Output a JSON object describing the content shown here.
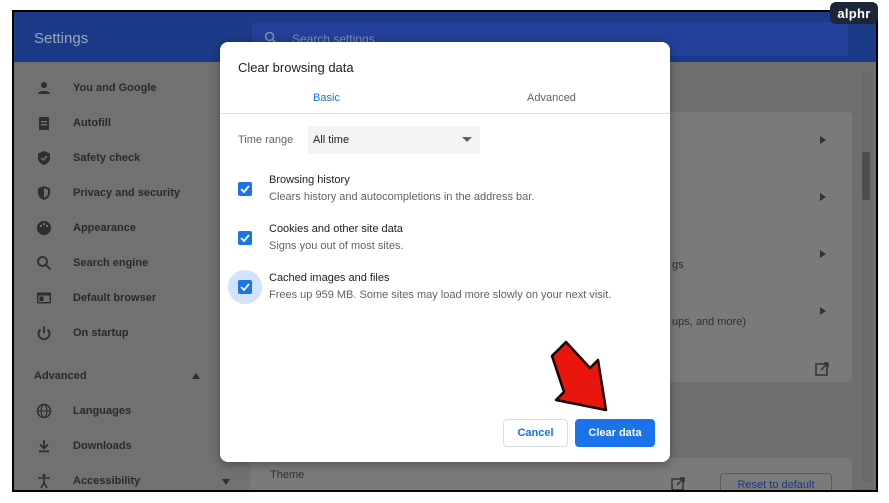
{
  "app": {
    "title": "Settings",
    "search_placeholder": "Search settings"
  },
  "sidebar": {
    "items": [
      {
        "label": "You and Google",
        "icon": "person-icon"
      },
      {
        "label": "Autofill",
        "icon": "clipboard-icon"
      },
      {
        "label": "Safety check",
        "icon": "shield-check-icon"
      },
      {
        "label": "Privacy and security",
        "icon": "shield-icon"
      },
      {
        "label": "Appearance",
        "icon": "palette-icon"
      },
      {
        "label": "Search engine",
        "icon": "search-icon"
      },
      {
        "label": "Default browser",
        "icon": "browser-icon"
      },
      {
        "label": "On startup",
        "icon": "power-icon"
      }
    ],
    "advanced_label": "Advanced",
    "advanced_items": [
      {
        "label": "Languages",
        "icon": "globe-icon"
      },
      {
        "label": "Downloads",
        "icon": "download-icon"
      },
      {
        "label": "Accessibility",
        "icon": "accessibility-icon"
      }
    ]
  },
  "background": {
    "peek_1": "gs",
    "peek_2": "ups, and more)",
    "theme_label": "Theme",
    "reset_label": "Reset to default"
  },
  "dialog": {
    "title": "Clear browsing data",
    "tabs": {
      "basic": "Basic",
      "advanced": "Advanced"
    },
    "time_range_label": "Time range",
    "time_range_value": "All time",
    "options": [
      {
        "title": "Browsing history",
        "desc": "Clears history and autocompletions in the address bar."
      },
      {
        "title": "Cookies and other site data",
        "desc": "Signs you out of most sites."
      },
      {
        "title": "Cached images and files",
        "desc": "Frees up 959 MB. Some sites may load more slowly on your next visit."
      }
    ],
    "cancel_label": "Cancel",
    "clear_label": "Clear data"
  },
  "badge": {
    "text": "alphr"
  },
  "colors": {
    "accent": "#1a73e8",
    "header": "#1b3a88",
    "arrow": "#e8160c"
  }
}
